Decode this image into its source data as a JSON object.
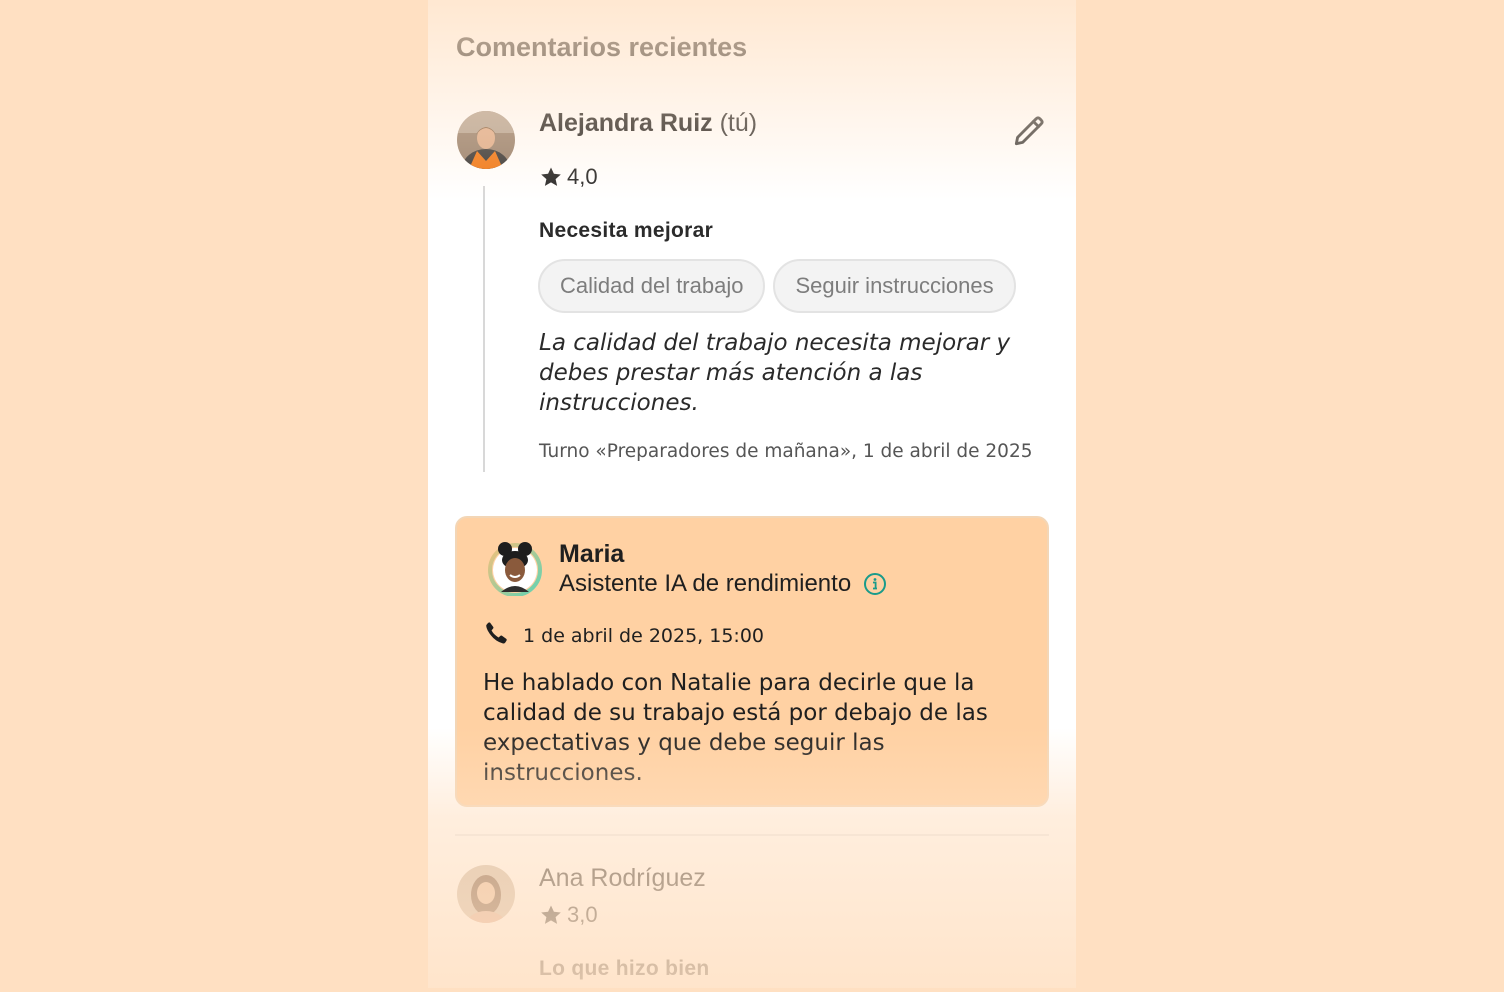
{
  "section": {
    "title": "Comentarios recientes"
  },
  "comment": {
    "author": "Alejandra Ruiz",
    "author_suffix": "(tú)",
    "rating": "4,0",
    "edit_icon": "pencil-icon",
    "improve_heading": "Necesita mejorar",
    "tags": [
      "Calidad del trabajo",
      "Seguir instrucciones"
    ],
    "text": "La calidad del trabajo necesita mejorar y debes prestar más atención a las instrucciones.",
    "meta": "Turno «Preparadores de mañana», 1 de abril de 2025"
  },
  "assistant": {
    "name": "Maria",
    "role": "Asistente IA de rendimiento",
    "info_icon": "info-icon",
    "call_icon": "phone-icon",
    "datetime": "1 de abril de 2025, 15:00",
    "message": "He hablado con Natalie para decirle que la calidad de su trabajo está por debajo de las expectativas y que debe seguir las instrucciones."
  },
  "next_comment": {
    "author": "Ana Rodríguez",
    "rating": "3,0",
    "heading": "Lo que hizo bien"
  },
  "colors": {
    "background": "#ffe0c2",
    "ai_card": "#ffd1a3",
    "info_accent": "#1a9b8a"
  }
}
